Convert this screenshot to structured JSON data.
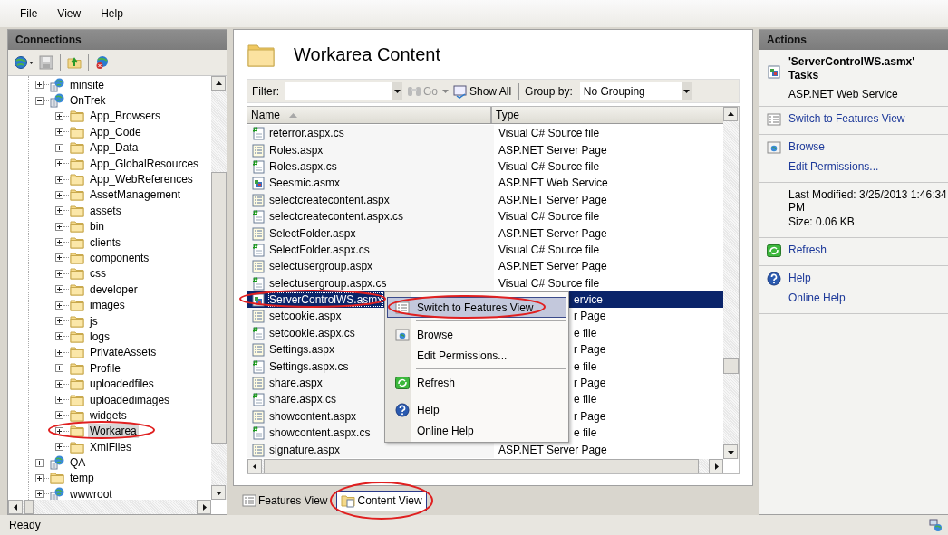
{
  "menu_bar": [
    {
      "label": "File"
    },
    {
      "label": "View"
    },
    {
      "label": "Help"
    }
  ],
  "connections": {
    "title": "Connections",
    "tree": [
      {
        "label": "minsite",
        "kind": "site",
        "expanded": false,
        "selected": false
      },
      {
        "label": "OnTrek",
        "kind": "site",
        "expanded": true,
        "selected": false,
        "children": [
          {
            "label": "App_Browsers",
            "kind": "folder",
            "expanded": false,
            "selected": false
          },
          {
            "label": "App_Code",
            "kind": "folder",
            "expanded": false,
            "selected": false
          },
          {
            "label": "App_Data",
            "kind": "folder",
            "expanded": false,
            "selected": false
          },
          {
            "label": "App_GlobalResources",
            "kind": "folder",
            "expanded": false,
            "selected": false
          },
          {
            "label": "App_WebReferences",
            "kind": "folder",
            "expanded": false,
            "selected": false
          },
          {
            "label": "AssetManagement",
            "kind": "folder",
            "expanded": false,
            "selected": false
          },
          {
            "label": "assets",
            "kind": "folder",
            "expanded": false,
            "selected": false
          },
          {
            "label": "bin",
            "kind": "folder",
            "expanded": false,
            "selected": false
          },
          {
            "label": "clients",
            "kind": "folder",
            "expanded": false,
            "selected": false
          },
          {
            "label": "components",
            "kind": "folder",
            "expanded": false,
            "selected": false
          },
          {
            "label": "css",
            "kind": "folder",
            "expanded": false,
            "selected": false
          },
          {
            "label": "developer",
            "kind": "folder",
            "expanded": false,
            "selected": false
          },
          {
            "label": "images",
            "kind": "folder",
            "expanded": false,
            "selected": false
          },
          {
            "label": "js",
            "kind": "folder",
            "expanded": false,
            "selected": false
          },
          {
            "label": "logs",
            "kind": "folder",
            "expanded": false,
            "selected": false
          },
          {
            "label": "PrivateAssets",
            "kind": "folder",
            "expanded": false,
            "selected": false
          },
          {
            "label": "Profile",
            "kind": "folder",
            "expanded": false,
            "selected": false
          },
          {
            "label": "uploadedfiles",
            "kind": "folder",
            "expanded": false,
            "selected": false
          },
          {
            "label": "uploadedimages",
            "kind": "folder",
            "expanded": false,
            "selected": false
          },
          {
            "label": "widgets",
            "kind": "folder",
            "expanded": false,
            "selected": false
          },
          {
            "label": "Workarea",
            "kind": "folder",
            "expanded": false,
            "selected": true
          },
          {
            "label": "XmlFiles",
            "kind": "folder",
            "expanded": false,
            "selected": false
          }
        ]
      },
      {
        "label": "QA",
        "kind": "site",
        "expanded": false,
        "selected": false
      },
      {
        "label": "temp",
        "kind": "folder",
        "expanded": false,
        "selected": false
      },
      {
        "label": "wwwroot",
        "kind": "site",
        "expanded": false,
        "selected": false
      }
    ]
  },
  "content": {
    "title": "Workarea Content",
    "filter": {
      "label": "Filter:"
    },
    "go": {
      "label": "Go",
      "disabled": true
    },
    "show_all": {
      "label": "Show All"
    },
    "group_by": {
      "label": "Group by:",
      "value": "No Grouping"
    },
    "columns": [
      "Name",
      "Type"
    ],
    "rows": [
      {
        "name": "reterror.aspx.cs",
        "type": "Visual C# Source file",
        "kind": "cs",
        "selected": false
      },
      {
        "name": "Roles.aspx",
        "type": "ASP.NET Server Page",
        "kind": "aspx",
        "selected": false
      },
      {
        "name": "Roles.aspx.cs",
        "type": "Visual C# Source file",
        "kind": "cs",
        "selected": false
      },
      {
        "name": "Seesmic.asmx",
        "type": "ASP.NET Web Service",
        "kind": "asmx",
        "selected": false
      },
      {
        "name": "selectcreatecontent.aspx",
        "type": "ASP.NET Server Page",
        "kind": "aspx",
        "selected": false
      },
      {
        "name": "selectcreatecontent.aspx.cs",
        "type": "Visual C# Source file",
        "kind": "cs",
        "selected": false
      },
      {
        "name": "SelectFolder.aspx",
        "type": "ASP.NET Server Page",
        "kind": "aspx",
        "selected": false
      },
      {
        "name": "SelectFolder.aspx.cs",
        "type": "Visual C# Source file",
        "kind": "cs",
        "selected": false
      },
      {
        "name": "selectusergroup.aspx",
        "type": "ASP.NET Server Page",
        "kind": "aspx",
        "selected": false
      },
      {
        "name": "selectusergroup.aspx.cs",
        "type": "Visual C# Source file",
        "kind": "cs",
        "selected": false
      },
      {
        "name": "ServerControlWS.asmx",
        "type": "ervice",
        "kind": "asmx",
        "selected": true
      },
      {
        "name": "setcookie.aspx",
        "type": "r Page",
        "kind": "aspx",
        "selected": false
      },
      {
        "name": "setcookie.aspx.cs",
        "type": "e file",
        "kind": "cs",
        "selected": false
      },
      {
        "name": "Settings.aspx",
        "type": "r Page",
        "kind": "aspx",
        "selected": false
      },
      {
        "name": "Settings.aspx.cs",
        "type": "e file",
        "kind": "cs",
        "selected": false
      },
      {
        "name": "share.aspx",
        "type": "r Page",
        "kind": "aspx",
        "selected": false
      },
      {
        "name": "share.aspx.cs",
        "type": "e file",
        "kind": "cs",
        "selected": false
      },
      {
        "name": "showcontent.aspx",
        "type": "r Page",
        "kind": "aspx",
        "selected": false
      },
      {
        "name": "showcontent.aspx.cs",
        "type": "e file",
        "kind": "cs",
        "selected": false
      },
      {
        "name": "signature.aspx",
        "type": "ASP.NET Server Page",
        "kind": "aspx",
        "selected": false
      }
    ],
    "context_menu": {
      "groups": [
        [
          {
            "label": "Switch to Features View",
            "selected": true
          }
        ],
        [
          {
            "label": "Browse",
            "selected": false
          },
          {
            "label": "Edit Permissions...",
            "selected": false
          }
        ],
        [
          {
            "label": "Refresh",
            "selected": false
          }
        ],
        [
          {
            "label": "Help",
            "selected": false
          },
          {
            "label": "Online Help",
            "selected": false
          }
        ]
      ]
    },
    "view_tabs": [
      {
        "label": "Features View",
        "kind": "features",
        "selected": false
      },
      {
        "label": "Content View",
        "kind": "content",
        "selected": true
      }
    ]
  },
  "actions": {
    "title": "Actions",
    "task_title": "'ServerControlWS.asmx' Tasks",
    "task_subtitle": "ASP.NET Web Service",
    "groups": [
      [
        {
          "kind": "link",
          "label": "Switch to Features View"
        }
      ],
      [
        {
          "kind": "link",
          "label": "Browse"
        },
        {
          "kind": "link",
          "label": "Edit Permissions..."
        }
      ],
      [
        {
          "kind": "text",
          "label": "Last Modified: 3/25/2013 1:46:34 PM"
        },
        {
          "kind": "text",
          "label": "Size: 0.06 KB"
        }
      ],
      [
        {
          "kind": "link",
          "label": "Refresh"
        }
      ],
      [
        {
          "kind": "link",
          "label": "Help"
        },
        {
          "kind": "link",
          "label": "Online Help"
        }
      ]
    ]
  },
  "status_bar": {
    "text": "Ready"
  }
}
